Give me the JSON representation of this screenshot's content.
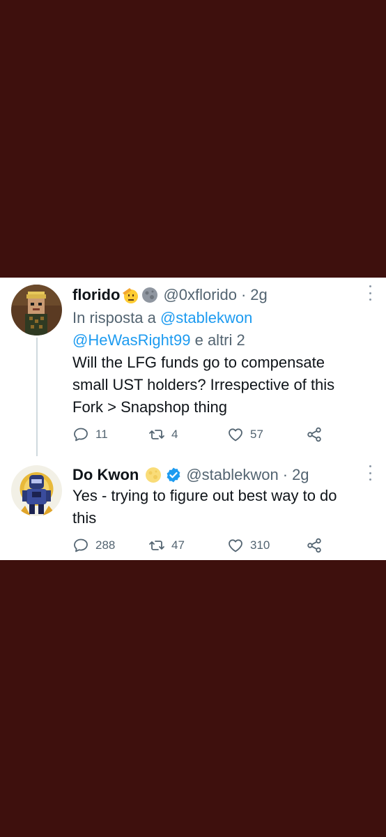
{
  "tweets": [
    {
      "name": "florido",
      "handle": "@0xflorido",
      "separator": "·",
      "time": "2g",
      "reply_prefix": "In risposta a",
      "reply_mention_1": "@stablekwon",
      "reply_mention_2": "@HeWasRight99",
      "reply_suffix": "e altri 2",
      "text_lines": [
        "Will the LFG funds go to compensate",
        "small UST holders? Irrespective of this",
        "Fork > Snapshop thing"
      ],
      "replies": "11",
      "retweets": "4",
      "likes": "57",
      "icons": [
        "saluting-face-emoji-icon",
        "moon-emoji-icon"
      ]
    },
    {
      "name": "Do Kwon",
      "handle": "@stablekwon",
      "separator": "·",
      "time": "2g",
      "text_lines": [
        "Yes - trying to figure out best way to do",
        "this"
      ],
      "replies": "288",
      "retweets": "47",
      "likes": "310",
      "icons": [
        "full-moon-emoji-icon",
        "verified-badge-icon"
      ]
    }
  ],
  "colors": {
    "background": "#3e100d",
    "card": "#ffffff",
    "link": "#1d9bf0",
    "secondary_text": "#536471",
    "primary_text": "#0f1419"
  }
}
